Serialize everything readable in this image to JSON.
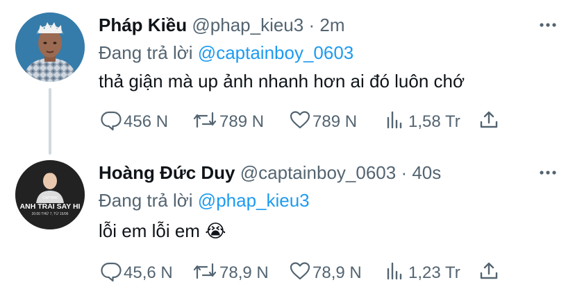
{
  "tweets": [
    {
      "name": "Pháp Kiều",
      "handle": "@phap_kieu3",
      "dot": "·",
      "time": "2m",
      "reply_prefix": "Đang trả lời",
      "reply_to": "@captainboy_0603",
      "text": "thả giận mà up ảnh nhanh hơn ai đó luôn chớ",
      "replies": "456 N",
      "retweets": "789 N",
      "likes": "789 N",
      "views": "1,58 Tr"
    },
    {
      "name": "Hoàng Đức Duy",
      "handle": "@captainboy_0603",
      "dot": "·",
      "time": "40s",
      "reply_prefix": "Đang trả lời",
      "reply_to": "@phap_kieu3",
      "text": "lỗi em lỗi em",
      "emoji": "😭",
      "replies": "45,6 N",
      "retweets": "78,9 N",
      "likes": "78,9 N",
      "views": "1,23 Tr",
      "avatar_text": {
        "line1": "CAPTAIN",
        "line2": "ANH TRAI SAY HI",
        "line3": "20:00 THỨ 7, TỪ 15/06"
      }
    }
  ],
  "icons": {
    "reply": "reply-icon",
    "retweet": "retweet-icon",
    "like": "heart-icon",
    "views": "views-icon",
    "share": "share-icon",
    "more": "more-icon"
  },
  "colors": {
    "text": "#0f1419",
    "secondary": "#536471",
    "mention": "#1d9bf0",
    "thread_line": "#cfd9de"
  }
}
